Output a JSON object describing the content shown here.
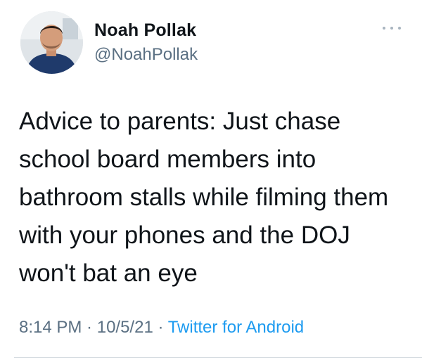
{
  "user": {
    "display_name": "Noah Pollak",
    "handle": "@NoahPollak"
  },
  "tweet": {
    "text": "Advice to parents: Just chase\nschool board members into\nbathroom stalls while filming them\nwith your phones and the DOJ\nwon't bat an eye",
    "time": "8:14 PM",
    "date": "10/5/21",
    "separator": " · ",
    "source": "Twitter for Android"
  },
  "icons": {
    "more": "more-options-icon",
    "avatar": "avatar"
  },
  "colors": {
    "text": "#0f1419",
    "secondary": "#5b7083",
    "link": "#1d9bf0"
  }
}
